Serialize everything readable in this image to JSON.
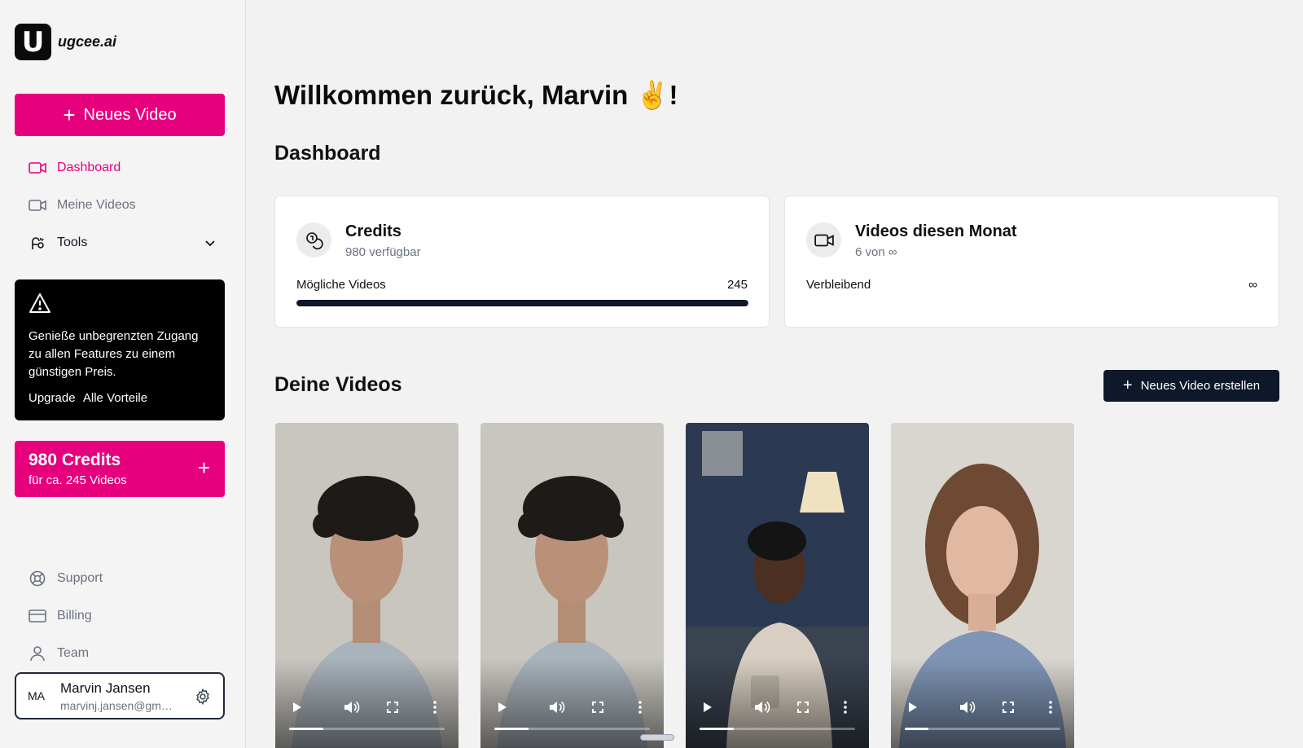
{
  "brand": {
    "logo_letter": "U",
    "name": "ugcee.ai"
  },
  "sidebar": {
    "new_video_label": "Neues Video",
    "nav": [
      {
        "label": "Dashboard",
        "icon": "video-camera-icon",
        "active": true
      },
      {
        "label": "Meine Videos",
        "icon": "video-camera-icon"
      },
      {
        "label": "Tools",
        "icon": "tools-icon"
      }
    ],
    "promo": {
      "text": "Genieße unbegrenzten Zugang zu allen Features zu einem günstigen Preis.",
      "upgrade": "Upgrade",
      "benefits": "Alle Vorteile"
    },
    "credits": {
      "amount": "980 Credits",
      "sub": "für ca. 245 Videos"
    },
    "bottom_nav": [
      {
        "label": "Support",
        "icon": "lifebuoy-icon"
      },
      {
        "label": "Billing",
        "icon": "credit-card-icon"
      },
      {
        "label": "Team",
        "icon": "user-icon"
      }
    ],
    "user": {
      "initials": "MA",
      "name": "Marvin Jansen",
      "email": "marvinj.jansen@gmail...."
    }
  },
  "main": {
    "welcome": "Willkommen zurück, Marvin ✌️!",
    "dashboard_title": "Dashboard",
    "cards": {
      "credits": {
        "title": "Credits",
        "sub": "980 verfügbar",
        "row_label": "Mögliche Videos",
        "row_value": "245",
        "progress": 1.0
      },
      "videos": {
        "title": "Videos diesen Monat",
        "sub": "6 von ∞",
        "row_label": "Verbleibend",
        "row_value": "∞"
      }
    },
    "videos_title": "Deine Videos",
    "create_button": "Neues Video erstellen",
    "videos": [
      {
        "progress": 0.22
      },
      {
        "progress": 0.22
      },
      {
        "progress": 0.22
      },
      {
        "progress": 0.15
      }
    ]
  },
  "colors": {
    "accent": "#e6007e",
    "dark": "#0f172a"
  }
}
